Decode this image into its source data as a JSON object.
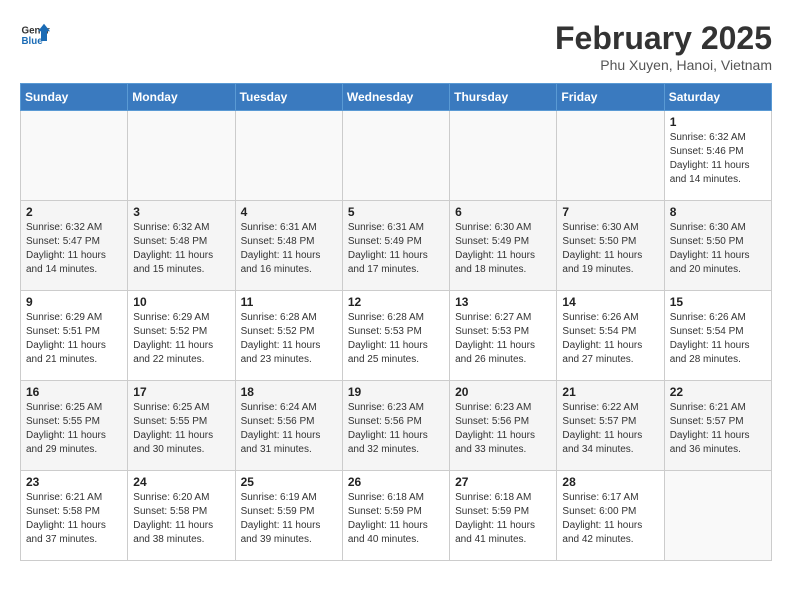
{
  "header": {
    "logo_general": "General",
    "logo_blue": "Blue",
    "title": "February 2025",
    "subtitle": "Phu Xuyen, Hanoi, Vietnam"
  },
  "days_of_week": [
    "Sunday",
    "Monday",
    "Tuesday",
    "Wednesday",
    "Thursday",
    "Friday",
    "Saturday"
  ],
  "weeks": [
    [
      {
        "day": "",
        "info": ""
      },
      {
        "day": "",
        "info": ""
      },
      {
        "day": "",
        "info": ""
      },
      {
        "day": "",
        "info": ""
      },
      {
        "day": "",
        "info": ""
      },
      {
        "day": "",
        "info": ""
      },
      {
        "day": "1",
        "info": "Sunrise: 6:32 AM\nSunset: 5:46 PM\nDaylight: 11 hours and 14 minutes."
      }
    ],
    [
      {
        "day": "2",
        "info": "Sunrise: 6:32 AM\nSunset: 5:47 PM\nDaylight: 11 hours and 14 minutes."
      },
      {
        "day": "3",
        "info": "Sunrise: 6:32 AM\nSunset: 5:48 PM\nDaylight: 11 hours and 15 minutes."
      },
      {
        "day": "4",
        "info": "Sunrise: 6:31 AM\nSunset: 5:48 PM\nDaylight: 11 hours and 16 minutes."
      },
      {
        "day": "5",
        "info": "Sunrise: 6:31 AM\nSunset: 5:49 PM\nDaylight: 11 hours and 17 minutes."
      },
      {
        "day": "6",
        "info": "Sunrise: 6:30 AM\nSunset: 5:49 PM\nDaylight: 11 hours and 18 minutes."
      },
      {
        "day": "7",
        "info": "Sunrise: 6:30 AM\nSunset: 5:50 PM\nDaylight: 11 hours and 19 minutes."
      },
      {
        "day": "8",
        "info": "Sunrise: 6:30 AM\nSunset: 5:50 PM\nDaylight: 11 hours and 20 minutes."
      }
    ],
    [
      {
        "day": "9",
        "info": "Sunrise: 6:29 AM\nSunset: 5:51 PM\nDaylight: 11 hours and 21 minutes."
      },
      {
        "day": "10",
        "info": "Sunrise: 6:29 AM\nSunset: 5:52 PM\nDaylight: 11 hours and 22 minutes."
      },
      {
        "day": "11",
        "info": "Sunrise: 6:28 AM\nSunset: 5:52 PM\nDaylight: 11 hours and 23 minutes."
      },
      {
        "day": "12",
        "info": "Sunrise: 6:28 AM\nSunset: 5:53 PM\nDaylight: 11 hours and 25 minutes."
      },
      {
        "day": "13",
        "info": "Sunrise: 6:27 AM\nSunset: 5:53 PM\nDaylight: 11 hours and 26 minutes."
      },
      {
        "day": "14",
        "info": "Sunrise: 6:26 AM\nSunset: 5:54 PM\nDaylight: 11 hours and 27 minutes."
      },
      {
        "day": "15",
        "info": "Sunrise: 6:26 AM\nSunset: 5:54 PM\nDaylight: 11 hours and 28 minutes."
      }
    ],
    [
      {
        "day": "16",
        "info": "Sunrise: 6:25 AM\nSunset: 5:55 PM\nDaylight: 11 hours and 29 minutes."
      },
      {
        "day": "17",
        "info": "Sunrise: 6:25 AM\nSunset: 5:55 PM\nDaylight: 11 hours and 30 minutes."
      },
      {
        "day": "18",
        "info": "Sunrise: 6:24 AM\nSunset: 5:56 PM\nDaylight: 11 hours and 31 minutes."
      },
      {
        "day": "19",
        "info": "Sunrise: 6:23 AM\nSunset: 5:56 PM\nDaylight: 11 hours and 32 minutes."
      },
      {
        "day": "20",
        "info": "Sunrise: 6:23 AM\nSunset: 5:56 PM\nDaylight: 11 hours and 33 minutes."
      },
      {
        "day": "21",
        "info": "Sunrise: 6:22 AM\nSunset: 5:57 PM\nDaylight: 11 hours and 34 minutes."
      },
      {
        "day": "22",
        "info": "Sunrise: 6:21 AM\nSunset: 5:57 PM\nDaylight: 11 hours and 36 minutes."
      }
    ],
    [
      {
        "day": "23",
        "info": "Sunrise: 6:21 AM\nSunset: 5:58 PM\nDaylight: 11 hours and 37 minutes."
      },
      {
        "day": "24",
        "info": "Sunrise: 6:20 AM\nSunset: 5:58 PM\nDaylight: 11 hours and 38 minutes."
      },
      {
        "day": "25",
        "info": "Sunrise: 6:19 AM\nSunset: 5:59 PM\nDaylight: 11 hours and 39 minutes."
      },
      {
        "day": "26",
        "info": "Sunrise: 6:18 AM\nSunset: 5:59 PM\nDaylight: 11 hours and 40 minutes."
      },
      {
        "day": "27",
        "info": "Sunrise: 6:18 AM\nSunset: 5:59 PM\nDaylight: 11 hours and 41 minutes."
      },
      {
        "day": "28",
        "info": "Sunrise: 6:17 AM\nSunset: 6:00 PM\nDaylight: 11 hours and 42 minutes."
      },
      {
        "day": "",
        "info": ""
      }
    ]
  ]
}
